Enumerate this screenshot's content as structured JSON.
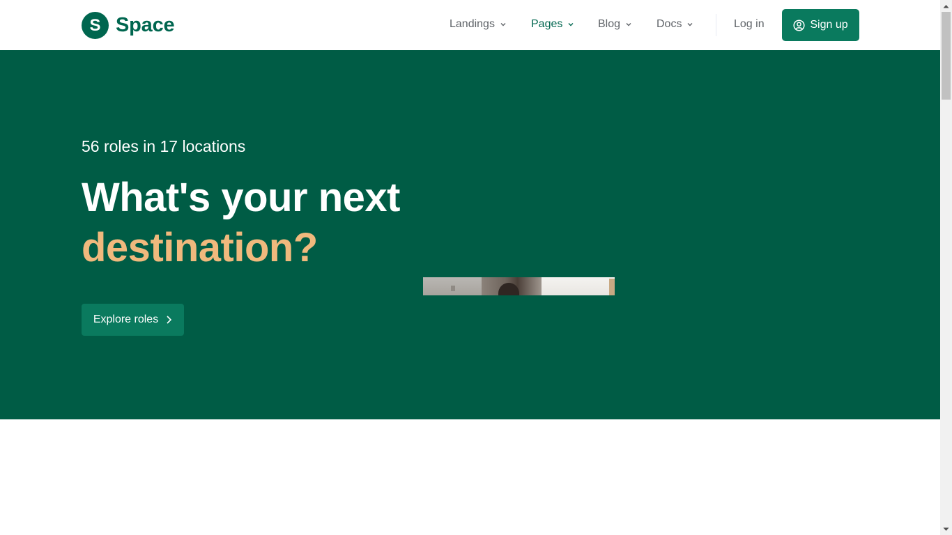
{
  "brand": {
    "badge_letter": "S",
    "name": "Space"
  },
  "nav": {
    "items": [
      {
        "label": "Landings",
        "active": false
      },
      {
        "label": "Pages",
        "active": true
      },
      {
        "label": "Blog",
        "active": false
      },
      {
        "label": "Docs",
        "active": false
      }
    ],
    "login_label": "Log in",
    "signup_label": "Sign up"
  },
  "hero": {
    "eyebrow": "56 roles in 17 locations",
    "title_line1": "What's your next",
    "title_line2": "destination?",
    "cta_label": "Explore roles"
  },
  "colors": {
    "brand": "#00664f",
    "hero_bg": "#005c45",
    "accent": "#f0b97d",
    "button": "#0a7a5e"
  },
  "icons": {
    "chevron": "chevron-down-icon",
    "user": "user-circle-icon",
    "arrow": "chevron-right-icon"
  }
}
